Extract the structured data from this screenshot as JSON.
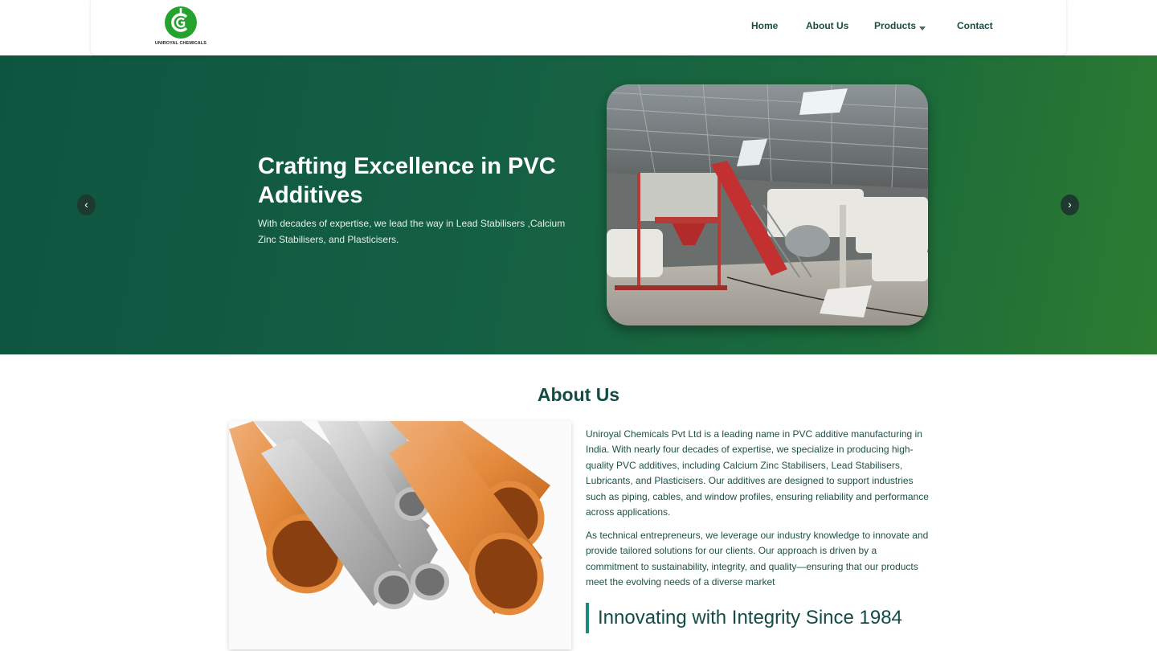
{
  "header": {
    "logo_text": "UNIROYAL CHEMICALS",
    "nav": {
      "home": "Home",
      "about": "About Us",
      "products": "Products",
      "contact": "Contact"
    }
  },
  "hero": {
    "title": "Crafting Excellence in PVC Additives",
    "subtitle": "With decades of expertise, we lead the way in Lead Stabilisers ,Calcium Zinc Stabilisers, and Plasticisers.",
    "prev_icon": "chevron-left-icon",
    "next_icon": "chevron-right-icon"
  },
  "about": {
    "title": "About Us",
    "paragraph1": "Uniroyal Chemicals Pvt Ltd is a leading name in PVC additive manufacturing in India. With nearly four decades of expertise, we specialize in producing high-quality PVC additives, including Calcium Zinc Stabilisers, Lead Stabilisers, Lubricants, and Plasticisers. Our additives are designed to support industries such as piping, cables, and window profiles, ensuring reliability and performance across applications.",
    "paragraph2": "As technical entrepreneurs, we leverage our industry knowledge to innovate and provide tailored solutions for our clients. Our approach is driven by a commitment to sustainability, integrity, and quality—ensuring that our products meet the evolving needs of a diverse market",
    "tagline": "Innovating with Integrity Since 1984"
  },
  "colors": {
    "brand_green": "#25a22e",
    "hero_start": "#0e5540",
    "hero_end": "#2d7c31",
    "heading": "#124c44",
    "accent_bar": "#1a8a7a"
  }
}
